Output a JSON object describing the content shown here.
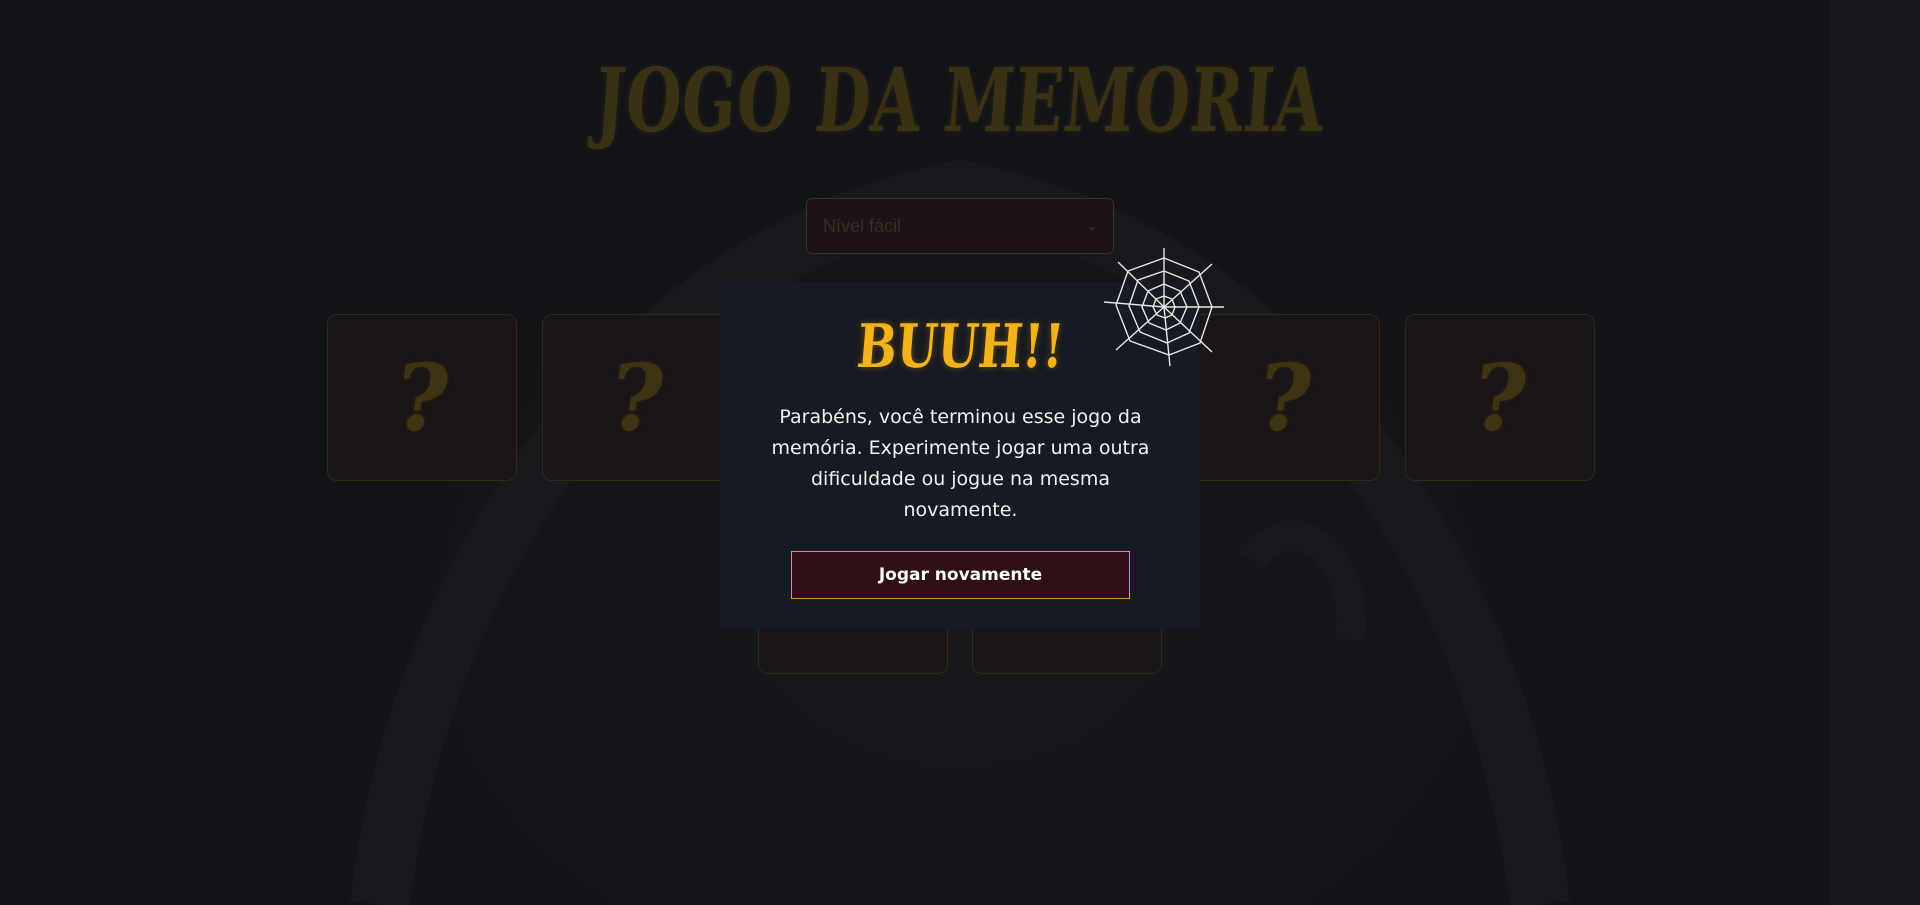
{
  "title": "JOGO DA MEMORIA",
  "level_select": {
    "selected": "Nível fácil"
  },
  "cards": [
    {
      "symbol": "?"
    },
    {
      "symbol": "?"
    },
    {
      "symbol": "?"
    },
    {
      "symbol": "?"
    },
    {
      "symbol": "?"
    },
    {
      "symbol": "?"
    }
  ],
  "modal": {
    "title": "BUUH!!",
    "message": "Parabéns, você terminou esse jogo da memória. Experimente jogar uma outra dificuldade ou jogue na mesma novamente.",
    "button_label": "Jogar novamente"
  },
  "colors": {
    "accent": "#f2b31d",
    "button_border": "#e59a2c",
    "button_bg": "#2e1015",
    "modal_bg": "#161a22"
  },
  "icons": {
    "decoration": "spider-web-icon",
    "select_arrow": "chevron-down-icon"
  }
}
